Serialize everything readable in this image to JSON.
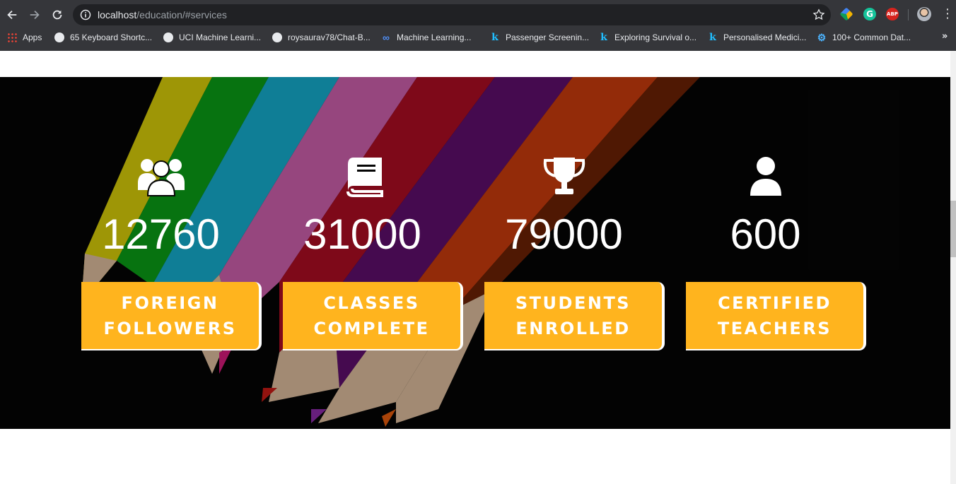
{
  "browser": {
    "url_host": "localhost",
    "url_path": "/education/#services",
    "bookmarks": [
      {
        "label": "Apps",
        "icon": "apps-grid-icon"
      },
      {
        "label": "65 Keyboard Shortc...",
        "icon": "globe-icon"
      },
      {
        "label": "UCI Machine Learni...",
        "icon": "globe-icon"
      },
      {
        "label": "roysaurav78/Chat-B...",
        "icon": "github-icon"
      },
      {
        "label": "Machine Learning...",
        "icon": "infinity-icon"
      },
      {
        "label": "Passenger Screenin...",
        "icon": "kaggle-icon"
      },
      {
        "label": "Exploring Survival o...",
        "icon": "kaggle-icon"
      },
      {
        "label": "Personalised Medici...",
        "icon": "kaggle-icon"
      },
      {
        "label": "100+ Common Dat...",
        "icon": "gear-icon"
      }
    ],
    "extensions": {
      "grammarly": "G",
      "adblock": "ABP"
    }
  },
  "stats": [
    {
      "icon": "users-icon",
      "value": "12760",
      "line1": "FOREIGN",
      "line2": "FOLLOWERS"
    },
    {
      "icon": "book-icon",
      "value": "31000",
      "line1": "CLASSES",
      "line2": "COMPLETE"
    },
    {
      "icon": "trophy-icon",
      "value": "79000",
      "line1": "STUDENTS",
      "line2": "ENROLLED"
    },
    {
      "icon": "user-icon",
      "value": "600",
      "line1": "CERTIFIED",
      "line2": "TEACHERS"
    }
  ],
  "colors": {
    "accent": "#ffb41e",
    "hero_bg": "#050505",
    "chrome_bg": "#35363a"
  }
}
